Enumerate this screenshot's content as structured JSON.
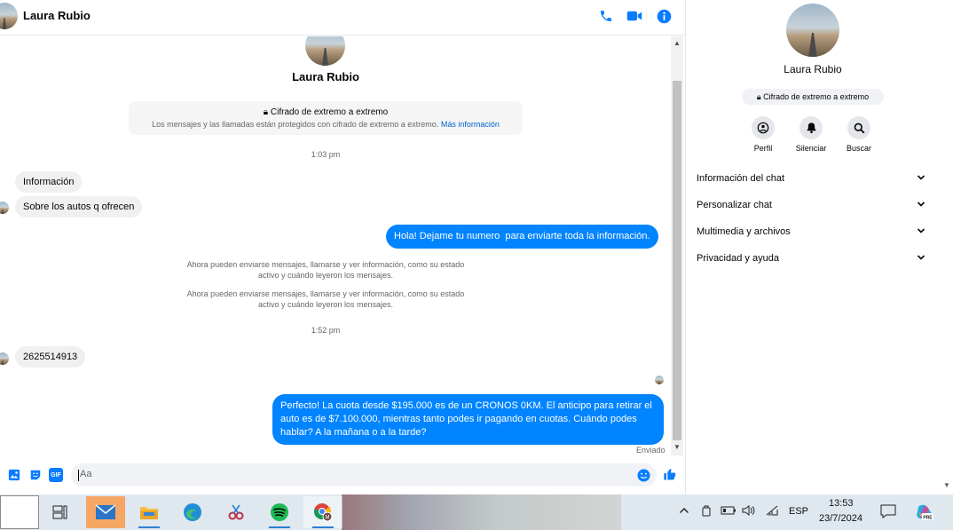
{
  "header": {
    "name": "Laura Rubio"
  },
  "chat": {
    "name": "Laura Rubio",
    "encryption_title": "Cifrado de extremo a extremo",
    "encryption_desc": "Los mensajes y las llamadas están protegidos con cifrado de extremo a extremo.",
    "encryption_link": "Más información",
    "ts1": "1:03 pm",
    "msg_in_1": "Información",
    "msg_in_2": "Sobre los autos q ofrecen",
    "msg_out_1": "Hola! Dejame tu numero  para enviarte toda la información.",
    "sys_1_line1": "Ahora pueden enviarse mensajes, llamarse y ver información, como su estado",
    "sys_1_line2": "activo y cuándo leyeron los mensajes.",
    "sys_2_line1": "Ahora pueden enviarse mensajes, llamarse y ver información, como su estado",
    "sys_2_line2": "activo y cuándo leyeron los mensajes.",
    "ts2": "1:52 pm",
    "msg_in_3": "2625514913",
    "msg_out_2_l1": "Perfecto! La cuota desde $195.000 es de un CRONOS 0KM. El anticipo para retirar el",
    "msg_out_2_l2": "auto es de $7.100.000, mientras tanto podes ir pagando en cuotas. Cuándo podes",
    "msg_out_2_l3": "hablar? A la mañana o a la tarde?",
    "sent_label": "Enviado"
  },
  "composer": {
    "placeholder": "Aa",
    "gif_label": "GIF"
  },
  "panel": {
    "name": "Laura Rubio",
    "badge": "Cifrado de extremo a extremo",
    "actions": [
      "Perfil",
      "Silenciar",
      "Buscar"
    ],
    "rows": [
      "Información del chat",
      "Personalizar chat",
      "Multimedia y archivos",
      "Privacidad y ayuda"
    ]
  },
  "taskbar": {
    "lang": "ESP",
    "time": "13:53",
    "date": "23/7/2024",
    "copilot_badge": "PRE"
  },
  "colors": {
    "accent": "#0084ff",
    "icon_blue": "#0a7cff",
    "incoming_bg": "#f0f0f0"
  }
}
